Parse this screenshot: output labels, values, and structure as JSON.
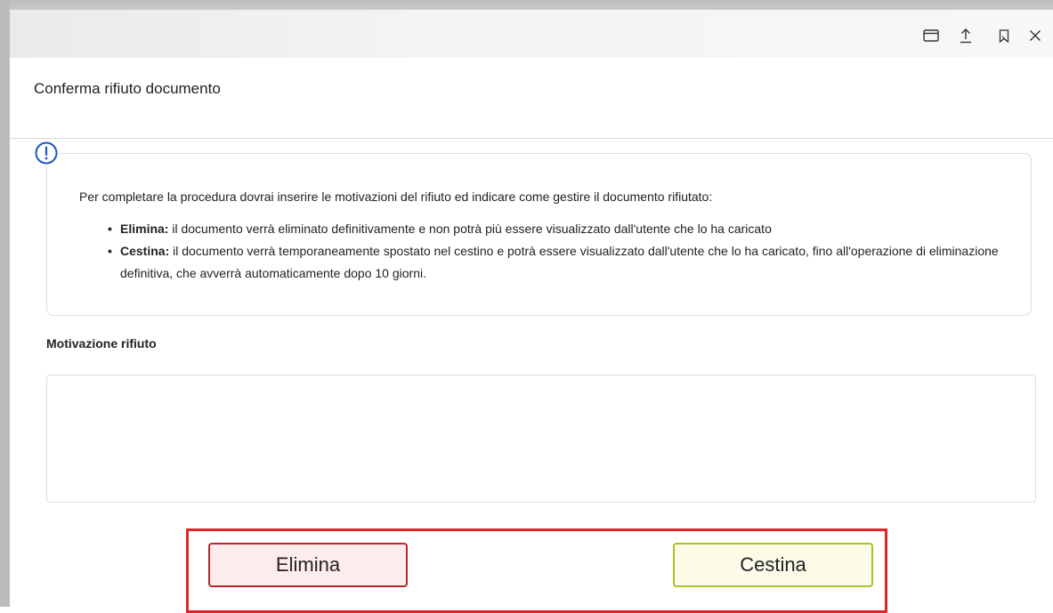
{
  "dialog": {
    "title": "Conferma rifiuto documento"
  },
  "toolbar": {
    "icons": [
      "window-icon",
      "upload-icon",
      "bookmark-icon",
      "close-icon"
    ]
  },
  "info": {
    "intro": "Per completare la procedura dovrai inserire le motivazioni del rifiuto ed indicare come gestire il documento rifiutato:",
    "items": [
      {
        "term": "Elimina:",
        "text": " il documento verrà eliminato definitivamente e non potrà più essere visualizzato dall'utente che lo ha caricato"
      },
      {
        "term": "Cestina:",
        "text": " il documento verrà temporaneamente spostato nel cestino e potrà essere visualizzato dall'utente che lo ha caricato, fino all'operazione di eliminazione definitiva, che avverrà automaticamente dopo 10 giorni."
      }
    ]
  },
  "form": {
    "reason_label": "Motivazione rifiuto",
    "reason_value": ""
  },
  "actions": {
    "elimina_label": "Elimina",
    "cestina_label": "Cestina"
  },
  "colors": {
    "info_icon": "#1a56c4",
    "highlight_border": "#e0242b",
    "elimina_border": "#b8262f",
    "elimina_bg": "#fdecec",
    "cestina_border": "#a7c22a",
    "cestina_bg": "#fbfbe7"
  }
}
